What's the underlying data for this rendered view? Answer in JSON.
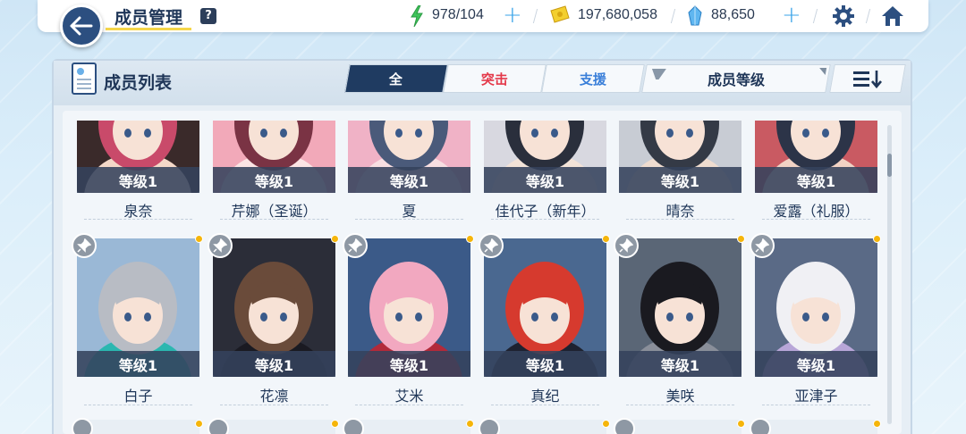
{
  "header": {
    "title": "成员管理",
    "help": "?",
    "ap": "978/104",
    "credits": "197,680,058",
    "gems": "88,650"
  },
  "panel": {
    "title": "成员列表",
    "tabs": [
      "全",
      "突击",
      "支援"
    ],
    "sort_label": "成员等级"
  },
  "colors": {
    "accent_navy": "#1f3b61",
    "striker_red": "#e4394a",
    "special_blue": "#3a7fd9",
    "plus_blue": "#39a3e8",
    "dot_yellow": "#f5b50a"
  },
  "row1": [
    {
      "level": "等级1",
      "name": "泉奈"
    },
    {
      "level": "等级1",
      "name": "芹娜（圣诞）"
    },
    {
      "level": "等级1",
      "name": "夏"
    },
    {
      "level": "等级1",
      "name": "佳代子（新年）"
    },
    {
      "level": "等级1",
      "name": "晴奈"
    },
    {
      "level": "等级1",
      "name": "爱露（礼服）"
    }
  ],
  "row2": [
    {
      "level": "等级1",
      "name": "白子"
    },
    {
      "level": "等级1",
      "name": "花凛"
    },
    {
      "level": "等级1",
      "name": "艾米"
    },
    {
      "level": "等级1",
      "name": "真纪"
    },
    {
      "level": "等级1",
      "name": "美咲"
    },
    {
      "level": "等级1",
      "name": "亚津子"
    }
  ]
}
